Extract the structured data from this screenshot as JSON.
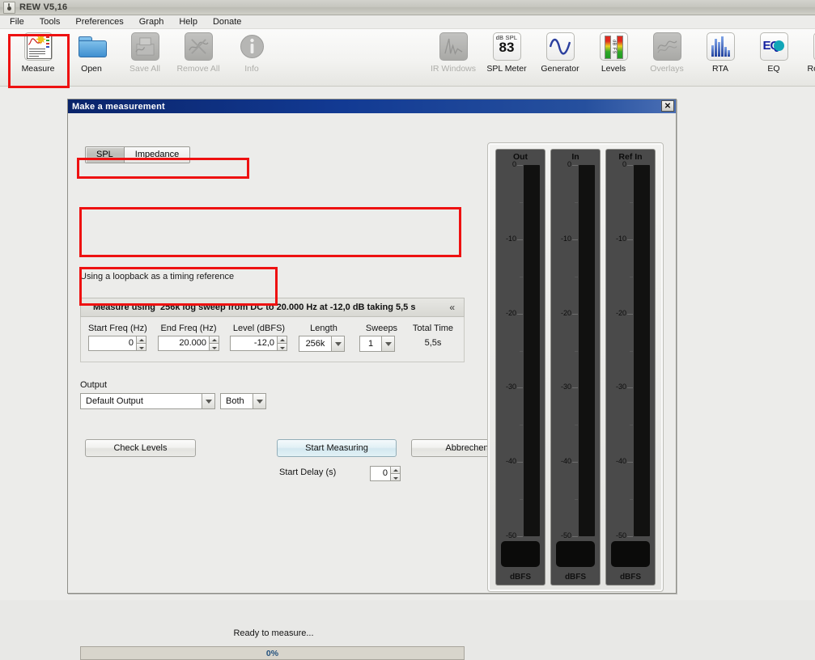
{
  "window": {
    "title": "REW V5,16",
    "icon": "java-icon"
  },
  "menubar": {
    "items": [
      {
        "label": "File"
      },
      {
        "label": "Tools"
      },
      {
        "label": "Preferences"
      },
      {
        "label": "Graph"
      },
      {
        "label": "Help"
      },
      {
        "label": "Donate"
      }
    ]
  },
  "toolbar": {
    "left": [
      {
        "label": "Measure",
        "icon": "measure-icon",
        "enabled": true,
        "selected": true
      },
      {
        "label": "Open",
        "icon": "folder-open-icon",
        "enabled": true,
        "selected": false
      },
      {
        "label": "Save All",
        "icon": "save-all-icon",
        "enabled": false,
        "selected": false
      },
      {
        "label": "Remove All",
        "icon": "remove-all-icon",
        "enabled": false,
        "selected": false
      },
      {
        "label": "Info",
        "icon": "info-icon",
        "enabled": false,
        "selected": false
      }
    ],
    "right": [
      {
        "label": "IR Windows",
        "icon": "ir-windows-icon",
        "enabled": false
      },
      {
        "label": "SPL Meter",
        "icon": "spl-meter-icon",
        "enabled": true,
        "spl_unit": "dB SPL",
        "spl_value": "83"
      },
      {
        "label": "Generator",
        "icon": "generator-icon",
        "enabled": true
      },
      {
        "label": "Levels",
        "icon": "levels-icon",
        "enabled": true,
        "levels_text": "dB FS"
      },
      {
        "label": "Overlays",
        "icon": "overlays-icon",
        "enabled": false
      },
      {
        "label": "RTA",
        "icon": "rta-icon",
        "enabled": true
      },
      {
        "label": "EQ",
        "icon": "eq-icon",
        "enabled": true,
        "eq_text": "EQ"
      },
      {
        "label": "Room Sim",
        "icon": "room-sim-icon",
        "enabled": true
      }
    ]
  },
  "dialog": {
    "title": "Make a measurement",
    "close_label": "✕",
    "tabs": [
      {
        "label": "SPL",
        "selected": true
      },
      {
        "label": "Impedance",
        "selected": false
      }
    ],
    "loopback_note": "Using a loopback as a timing reference",
    "measure_using": {
      "lead": "Measure using",
      "detail": "256k log sweep from DC to 20.000 Hz at -12,0 dB taking 5,5 s",
      "collapse_icon": "«"
    },
    "sweep_fields": [
      {
        "name": "start-freq",
        "label": "Start Freq (Hz)",
        "value": "0",
        "type": "spinner"
      },
      {
        "name": "end-freq",
        "label": "End Freq (Hz)",
        "value": "20.000",
        "type": "spinner"
      },
      {
        "name": "level",
        "label": "Level (dBFS)",
        "value": "-12,0",
        "type": "spinner"
      },
      {
        "name": "length",
        "label": "Length",
        "value": "256k",
        "type": "combo"
      },
      {
        "name": "sweeps",
        "label": "Sweeps",
        "value": "1",
        "type": "combo"
      },
      {
        "name": "total-time",
        "label": "Total Time",
        "value": "5,5s",
        "type": "text"
      }
    ],
    "output": {
      "group_label": "Output",
      "device": "Default Output",
      "channel": "Both"
    },
    "buttons": {
      "check_levels": "Check Levels",
      "start_measuring": "Start Measuring",
      "cancel": "Abbrechen"
    },
    "start_delay": {
      "label": "Start Delay (s)",
      "value": "0"
    },
    "status": "Ready to measure...",
    "progress": {
      "percent_label": "0%",
      "value": 0
    }
  },
  "meters": {
    "scale_labels": [
      "0",
      "-10",
      "-20",
      "-30",
      "-40",
      "-50"
    ],
    "channels": [
      {
        "name": "Out",
        "unit": "dBFS",
        "readout": ""
      },
      {
        "name": "In",
        "unit": "dBFS",
        "readout": ""
      },
      {
        "name": "Ref In",
        "unit": "dBFS",
        "readout": ""
      }
    ]
  },
  "annotations": {
    "color": "#ee1111",
    "boxes": [
      {
        "name": "measure-toolbar-button"
      },
      {
        "name": "loopback-note"
      },
      {
        "name": "sweep-parameters"
      },
      {
        "name": "output-section"
      }
    ]
  }
}
